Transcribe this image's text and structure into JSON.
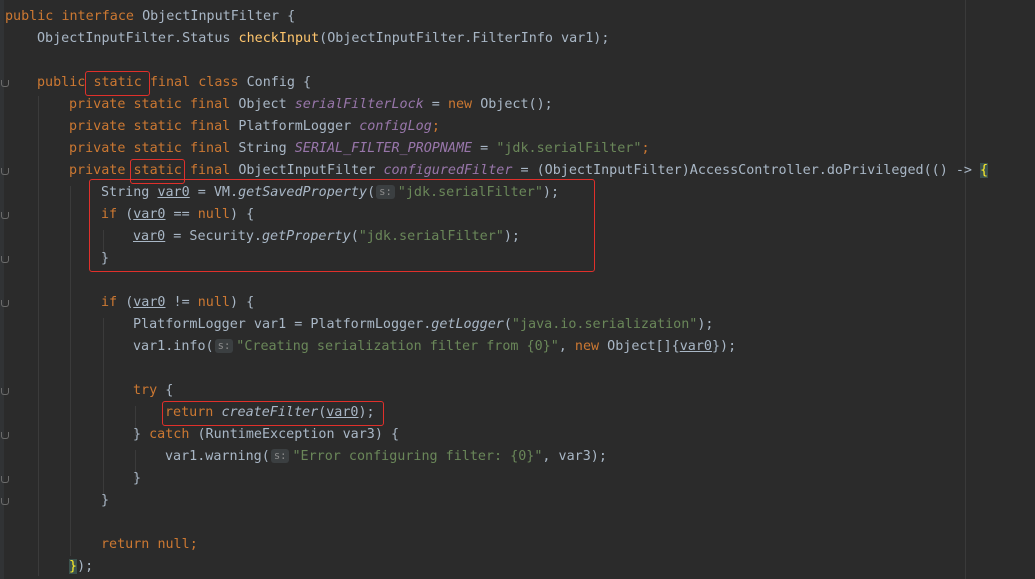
{
  "editor": {
    "lines": [
      {
        "tokens": [
          [
            "kw",
            "public "
          ],
          [
            "kw",
            "interface "
          ],
          [
            "type",
            "ObjectInputFilter {"
          ]
        ]
      },
      {
        "tokens": [
          [
            "type",
            "ObjectInputFilter.Status "
          ],
          [
            "method",
            "checkInput"
          ],
          [
            "type",
            "(ObjectInputFilter.FilterInfo var1);"
          ]
        ]
      },
      {
        "tokens": []
      },
      {
        "tokens": [
          [
            "kw",
            "public "
          ],
          [
            "kw",
            "static "
          ],
          [
            "kw",
            "final "
          ],
          [
            "kw",
            "class "
          ],
          [
            "type",
            "Config {"
          ]
        ]
      },
      {
        "tokens": [
          [
            "kw",
            "private "
          ],
          [
            "kw",
            "static "
          ],
          [
            "kw",
            "final "
          ],
          [
            "type",
            "Object "
          ],
          [
            "field",
            "serialFilterLock"
          ],
          [
            "type",
            " = "
          ],
          [
            "kw",
            "new "
          ],
          [
            "type",
            "Object();"
          ]
        ]
      },
      {
        "tokens": [
          [
            "kw",
            "private "
          ],
          [
            "kw",
            "static "
          ],
          [
            "kw",
            "final "
          ],
          [
            "type",
            "PlatformLogger "
          ],
          [
            "field",
            "configLog"
          ],
          [
            "kw",
            ";"
          ]
        ]
      },
      {
        "tokens": [
          [
            "kw",
            "private "
          ],
          [
            "kw",
            "static "
          ],
          [
            "kw",
            "final "
          ],
          [
            "type",
            "String "
          ],
          [
            "const",
            "SERIAL_FILTER_PROPNAME"
          ],
          [
            "type",
            " = "
          ],
          [
            "str",
            "\"jdk.serialFilter\""
          ],
          [
            "kw",
            ";"
          ]
        ]
      },
      {
        "tokens": [
          [
            "kw",
            "private "
          ],
          [
            "kw",
            "static "
          ],
          [
            "kw",
            "final "
          ],
          [
            "type",
            "ObjectInputFilter "
          ],
          [
            "field",
            "configuredFilter"
          ],
          [
            "type",
            " = (ObjectInputFilter)AccessController.doPrivileged(() -> "
          ],
          [
            "brace",
            "{"
          ]
        ]
      },
      {
        "tokens": [
          [
            "type",
            "String "
          ],
          [
            "local",
            "var0"
          ],
          [
            "type",
            " = VM."
          ],
          [
            "static-call",
            "getSavedProperty"
          ],
          [
            "type",
            "("
          ],
          [
            "hint",
            "s:"
          ],
          [
            "str",
            "\"jdk.serialFilter\""
          ],
          [
            "type",
            ");"
          ]
        ]
      },
      {
        "tokens": [
          [
            "kw",
            "if "
          ],
          [
            "type",
            "("
          ],
          [
            "local",
            "var0"
          ],
          [
            "type",
            " == "
          ],
          [
            "kw",
            "null"
          ],
          [
            "type",
            ") {"
          ]
        ]
      },
      {
        "tokens": [
          [
            "local",
            "var0"
          ],
          [
            "type",
            " = Security."
          ],
          [
            "static-call",
            "getProperty"
          ],
          [
            "type",
            "("
          ],
          [
            "str",
            "\"jdk.serialFilter\""
          ],
          [
            "type",
            ");"
          ]
        ]
      },
      {
        "tokens": [
          [
            "type",
            "}"
          ]
        ]
      },
      {
        "tokens": []
      },
      {
        "tokens": [
          [
            "kw",
            "if "
          ],
          [
            "type",
            "("
          ],
          [
            "local",
            "var0"
          ],
          [
            "type",
            " != "
          ],
          [
            "kw",
            "null"
          ],
          [
            "type",
            ") {"
          ]
        ]
      },
      {
        "tokens": [
          [
            "type",
            "PlatformLogger var1 = PlatformLogger."
          ],
          [
            "static-call",
            "getLogger"
          ],
          [
            "type",
            "("
          ],
          [
            "str",
            "\"java.io.serialization\""
          ],
          [
            "type",
            ");"
          ]
        ]
      },
      {
        "tokens": [
          [
            "type",
            "var1.info("
          ],
          [
            "hint",
            "s:"
          ],
          [
            "str",
            "\"Creating serialization filter from {0}\""
          ],
          [
            "type",
            ", "
          ],
          [
            "kw",
            "new "
          ],
          [
            "type",
            "Object[]{"
          ],
          [
            "local",
            "var0"
          ],
          [
            "type",
            "});"
          ]
        ]
      },
      {
        "tokens": []
      },
      {
        "tokens": [
          [
            "kw",
            "try "
          ],
          [
            "type",
            "{"
          ]
        ]
      },
      {
        "tokens": [
          [
            "kw",
            "return "
          ],
          [
            "static-call",
            "createFilter"
          ],
          [
            "type",
            "("
          ],
          [
            "local",
            "var0"
          ],
          [
            "type",
            ");"
          ]
        ]
      },
      {
        "tokens": [
          [
            "type",
            "} "
          ],
          [
            "kw",
            "catch "
          ],
          [
            "type",
            "(RuntimeException var3) {"
          ]
        ]
      },
      {
        "tokens": [
          [
            "type",
            "var1.warning("
          ],
          [
            "hint",
            "s:"
          ],
          [
            "str",
            "\"Error configuring filter: {0}\""
          ],
          [
            "type",
            ", var3);"
          ]
        ]
      },
      {
        "tokens": [
          [
            "type",
            "}"
          ]
        ]
      },
      {
        "tokens": [
          [
            "type",
            "}"
          ]
        ]
      },
      {
        "tokens": []
      },
      {
        "tokens": [
          [
            "kw",
            "return "
          ],
          [
            "kw",
            "null"
          ],
          [
            "kw",
            ";"
          ]
        ]
      },
      {
        "tokens": [
          [
            "brace",
            "}"
          ],
          [
            "type",
            ");"
          ]
        ]
      }
    ]
  }
}
